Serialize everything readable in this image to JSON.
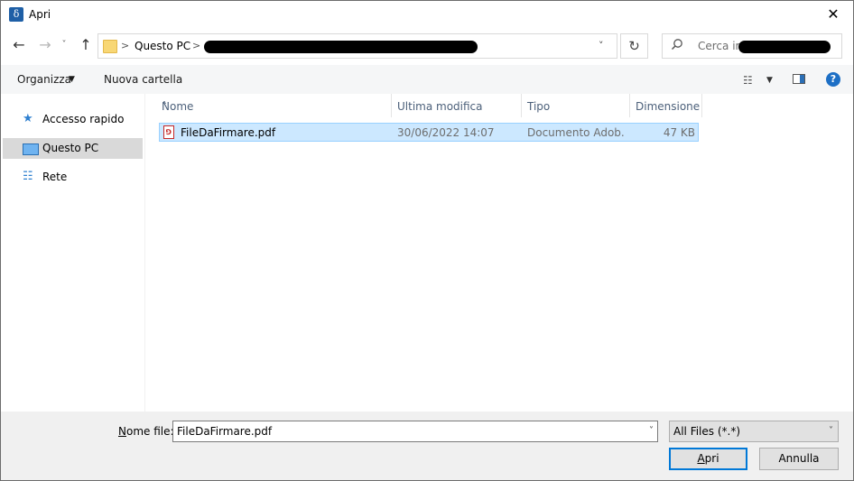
{
  "window": {
    "title": "Apri",
    "app_icon_glyph": "δ",
    "close_glyph": "✕"
  },
  "navigation": {
    "back_glyph": "←",
    "forward_glyph": "→",
    "recent_glyph": "˅",
    "up_glyph": "↑"
  },
  "address": {
    "separator": ">",
    "location": "Questo PC",
    "dropdown_glyph": "˅",
    "refresh_glyph": "↻"
  },
  "search": {
    "placeholder": "Cerca in",
    "icon": "search-icon"
  },
  "commandbar": {
    "organize_label": "Organizza",
    "organize_arrow": "▼",
    "new_folder_label": "Nuova cartella",
    "view_glyph": "☷",
    "view_arrow": "▼",
    "help_glyph": "?"
  },
  "sidebar": {
    "items": [
      {
        "label": "Accesso rapido",
        "icon": "star-icon",
        "glyph": "★"
      },
      {
        "label": "Questo PC",
        "icon": "computer-icon",
        "glyph": ""
      },
      {
        "label": "Rete",
        "icon": "network-icon",
        "glyph": "☷"
      }
    ]
  },
  "filelist": {
    "columns": [
      "Nome",
      "Ultima modifica",
      "Tipo",
      "Dimensione"
    ],
    "sort_glyph": "˄",
    "rows": [
      {
        "name": "FileDaFirmare.pdf",
        "modified": "30/06/2022 14:07",
        "type": "Documento Adob...",
        "size": "47 KB",
        "icon_glyph": "☷"
      }
    ]
  },
  "footer": {
    "filename_label_prefix": "N",
    "filename_label_rest": "ome file:",
    "filename_value": "FileDaFirmare.pdf",
    "filename_arrow": "˅",
    "filter_value": "All Files (*.*)",
    "filter_arrow": "˅",
    "open_label_prefix": "A",
    "open_label_rest": "pri",
    "cancel_label": "Annulla"
  },
  "colors": {
    "accent": "#0078d7",
    "selection": "#cce8ff",
    "header_text": "#4c607a"
  }
}
